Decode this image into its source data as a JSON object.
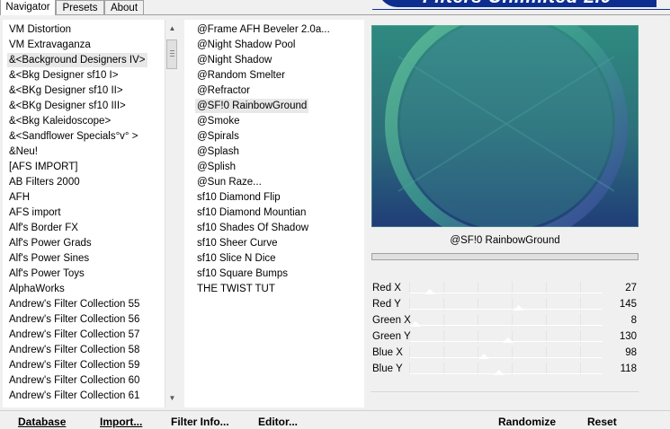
{
  "tabs": [
    "Navigator",
    "Presets",
    "About"
  ],
  "banner_title": "Filters Unlimited 2.0",
  "categories": [
    "VM Distortion",
    "VM Extravaganza",
    "&<Background Designers IV>",
    "&<Bkg Designer sf10 I>",
    "&<BKg Designer sf10 II>",
    "&<BKg Designer sf10 III>",
    "&<Bkg Kaleidoscope>",
    "&<Sandflower Specials°v° >",
    "&Neu!",
    "[AFS IMPORT]",
    "AB Filters 2000",
    "AFH",
    "AFS import",
    "Alf's Border FX",
    "Alf's Power Grads",
    "Alf's Power Sines",
    "Alf's Power Toys",
    "AlphaWorks",
    "Andrew's Filter Collection 55",
    "Andrew's Filter Collection 56",
    "Andrew's Filter Collection 57",
    "Andrew's Filter Collection 58",
    "Andrew's Filter Collection 59",
    "Andrew's Filter Collection 60",
    "Andrew's Filter Collection 61"
  ],
  "selected_category": "&<Background Designers IV>",
  "filters": [
    "@Frame AFH Beveler 2.0a...",
    "@Night Shadow Pool",
    "@Night Shadow",
    "@Random Smelter",
    "@Refractor",
    "@SF!0 RainbowGround",
    "@Smoke",
    "@Spirals",
    "@Splash",
    "@Splish",
    "@Sun Raze...",
    "sf10 Diamond Flip",
    "sf10 Diamond Mountian",
    "sf10 Shades Of Shadow",
    "sf10 Sheer Curve",
    "sf10 Slice N Dice",
    "sf10 Square Bumps",
    "THE TWIST TUT"
  ],
  "selected_filter": "@SF!0 RainbowGround",
  "preview_filter_name": "@SF!0 RainbowGround",
  "params": [
    {
      "label": "Red X",
      "value": "27",
      "fraction": 0.106
    },
    {
      "label": "Red Y",
      "value": "145",
      "fraction": 0.569
    },
    {
      "label": "Green X",
      "value": "8",
      "fraction": 0.031
    },
    {
      "label": "Green Y",
      "value": "130",
      "fraction": 0.51
    },
    {
      "label": "Blue X",
      "value": "98",
      "fraction": 0.384
    },
    {
      "label": "Blue Y",
      "value": "118",
      "fraction": 0.463
    }
  ],
  "bottom_bar": {
    "database": "Database",
    "import": "Import...",
    "filter_info": "Filter Info...",
    "editor": "Editor...",
    "randomize": "Randomize",
    "reset": "Reset"
  },
  "colors": {
    "banner": "#0d2e8f",
    "selection": "#e8e8e8"
  }
}
